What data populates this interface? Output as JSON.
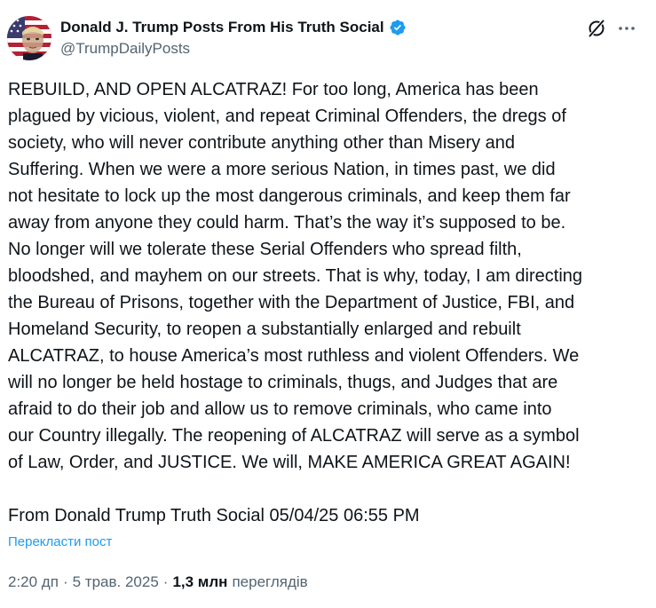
{
  "author": {
    "display_name": "Donald J. Trump Posts From His Truth Social",
    "handle": "@TrumpDailyPosts",
    "verified": true
  },
  "icons": {
    "verified": "verified-badge-icon",
    "grok": "grok-icon",
    "more": "more-options-icon",
    "avatar": "flag-portrait-avatar"
  },
  "colors": {
    "accent": "#1d9bf0",
    "text": "#0f1419",
    "secondary": "#536471"
  },
  "post": {
    "text": "REBUILD, AND OPEN ALCATRAZ! For too long, America has been\nplagued by vicious, violent, and repeat Criminal Offenders, the dregs of\nsociety, who will never contribute anything other than Misery and\nSuffering. When we were a more serious Nation, in times past, we did\nnot hesitate to lock up the most dangerous criminals, and keep them far\naway from anyone they could harm. That’s the way it’s supposed to be.\nNo longer will we tolerate these Serial Offenders who spread filth,\nbloodshed, and mayhem on our streets. That is why, today, I am directing\nthe Bureau of Prisons, together with the Department of Justice, FBI, and\nHomeland Security, to reopen a substantially enlarged and rebuilt\nALCATRAZ, to house America’s most ruthless and violent Offenders. We\nwill no longer be held hostage to criminals, thugs, and Judges that are\nafraid to do their job and allow us to remove criminals, who came into\nour Country illegally. The reopening of ALCATRAZ will serve as a symbol\nof Law, Order, and JUSTICE. We will, MAKE AMERICA GREAT AGAIN!",
    "source_line": "From Donald Trump Truth Social 05/04/25 06:55 PM",
    "translate_label": "Перекласти пост"
  },
  "meta": {
    "time": "2:20 дп",
    "separator": "·",
    "date": "5 трав. 2025",
    "views_count": "1,3 млн",
    "views_label": "переглядів"
  }
}
